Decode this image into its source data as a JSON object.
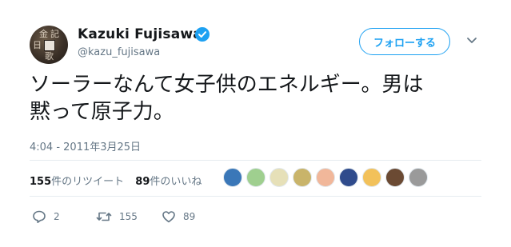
{
  "user": {
    "display_name": "Kazuki Fujisawa",
    "handle": "@kazu_fujisawa",
    "avatar_glyphs": [
      "金",
      "記",
      "日",
      "歌"
    ]
  },
  "follow_button": {
    "label": "フォローする"
  },
  "tweet": {
    "text_line1": "ソーラーなんて女子供のエネルギー。男は",
    "text_line2": "黙って原子力。",
    "timestamp": "4:04 - 2011年3月25日"
  },
  "stats": {
    "retweets_count": "155",
    "retweets_label": "件のリツイート",
    "likes_count": "89",
    "likes_label": "件のいいね"
  },
  "actions": {
    "reply_count": "2",
    "retweet_count": "155",
    "like_count": "89"
  },
  "colors": {
    "accent": "#1da1f2",
    "muted": "#657786",
    "text": "#14171a",
    "divider": "#e6ecf0"
  },
  "icons": [
    "verified-badge-icon",
    "chevron-down-icon",
    "reply-icon",
    "retweet-icon",
    "heart-icon"
  ]
}
